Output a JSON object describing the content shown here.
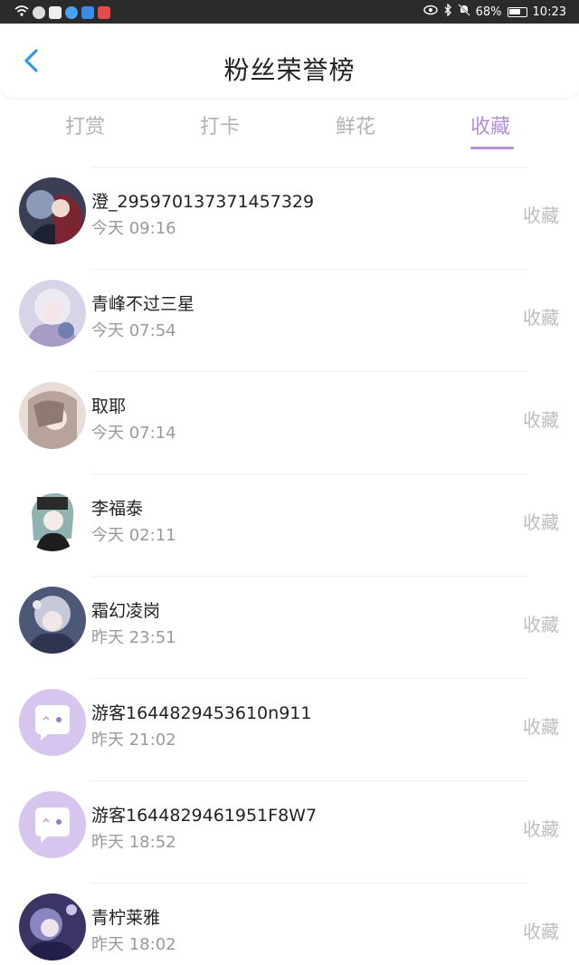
{
  "status_bar": {
    "battery": "68%",
    "time": "10:23"
  },
  "header": {
    "title": "粉丝荣誉榜"
  },
  "tabs": [
    {
      "label": "打赏",
      "active": false
    },
    {
      "label": "打卡",
      "active": false
    },
    {
      "label": "鲜花",
      "active": false
    },
    {
      "label": "收藏",
      "active": true
    }
  ],
  "colors": {
    "accent": "#b28fd6",
    "back_arrow": "#2f9be6",
    "guest_avatar_bg": "#d6c5ef"
  },
  "fans": [
    {
      "name": "澄_295970137371457329",
      "time": "今天 09:16",
      "action": "收藏",
      "avatar": "anime-avatar"
    },
    {
      "name": "青峰不过三星",
      "time": "今天 07:54",
      "action": "收藏",
      "avatar": "anime-avatar"
    },
    {
      "name": "取耶",
      "time": "今天 07:14",
      "action": "收藏",
      "avatar": "anime-avatar"
    },
    {
      "name": "李福泰",
      "time": "今天 02:11",
      "action": "收藏",
      "avatar": "anime-avatar"
    },
    {
      "name": "霜幻凌岗",
      "time": "昨天 23:51",
      "action": "收藏",
      "avatar": "anime-avatar"
    },
    {
      "name": "游客1644829453610n911",
      "time": "昨天 21:02",
      "action": "收藏",
      "avatar": "guest-chat-icon"
    },
    {
      "name": "游客1644829461951F8W7",
      "time": "昨天 18:52",
      "action": "收藏",
      "avatar": "guest-chat-icon"
    },
    {
      "name": "青柠莱雅",
      "time": "昨天 18:02",
      "action": "收藏",
      "avatar": "anime-avatar"
    }
  ]
}
